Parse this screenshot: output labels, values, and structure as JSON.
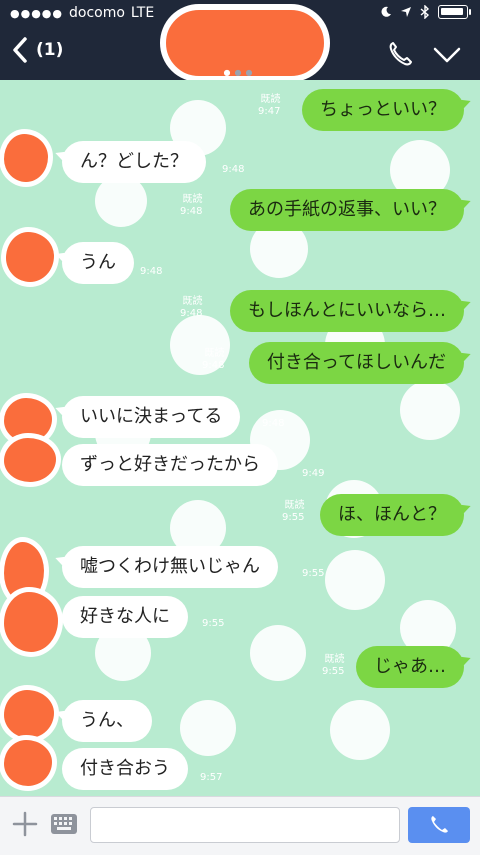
{
  "status_bar": {
    "signal": "●●●●●",
    "carrier": "docomo",
    "network": "LTE",
    "icons": [
      "moon-icon",
      "location-arrow-icon",
      "bluetooth-icon",
      "battery-icon"
    ],
    "battery_level": 0.95
  },
  "header": {
    "back_count": "(1)",
    "contact_name": "",
    "page_indicator": {
      "pages": 3,
      "current": 1
    },
    "icons": [
      "back-chevron-icon",
      "phone-icon",
      "chevron-down-icon"
    ]
  },
  "messages": [
    {
      "dir": "out",
      "text": "ちょっといい？",
      "read": "既読",
      "time": "9:47"
    },
    {
      "dir": "in",
      "text": "ん？どした？",
      "time": "9:48"
    },
    {
      "dir": "out",
      "text": "あの手紙の返事、いい？",
      "read": "既読",
      "time": "9:48"
    },
    {
      "dir": "in",
      "text": "うん",
      "time": "9:48"
    },
    {
      "dir": "out",
      "text": "もしほんとにいいなら…",
      "read": "既読",
      "time": "9:48"
    },
    {
      "dir": "out",
      "text": "付き合ってほしいんだ",
      "read": "既読",
      "time": "9:48"
    },
    {
      "dir": "in",
      "text": "いいに決まってる",
      "time": "9:48"
    },
    {
      "dir": "in",
      "text": "ずっと好きだったから",
      "time": "9:49"
    },
    {
      "dir": "out",
      "text": "ほ、ほんと？",
      "read": "既読",
      "time": "9:55"
    },
    {
      "dir": "in",
      "text": "嘘つくわけ無いじゃん",
      "time": "9:55"
    },
    {
      "dir": "in",
      "text": "好きな人に",
      "time": "9:55"
    },
    {
      "dir": "out",
      "text": "じゃあ…",
      "read": "既読",
      "time": "9:55"
    },
    {
      "dir": "in",
      "text": "うん、",
      "time": "9:57"
    },
    {
      "dir": "in",
      "text": "付き合おう",
      "time": "9:57"
    }
  ],
  "input_bar": {
    "value": "",
    "icons": [
      "plus-icon",
      "keyboard-icon",
      "phone-send-icon"
    ]
  },
  "colors": {
    "header_bg": "#1f2839",
    "chat_bg": "#b8ebd0",
    "outgoing_bubble": "#7cd644",
    "incoming_bubble": "#ffffff",
    "redaction": "#fa6d3c",
    "send_button": "#5a8ff0"
  }
}
